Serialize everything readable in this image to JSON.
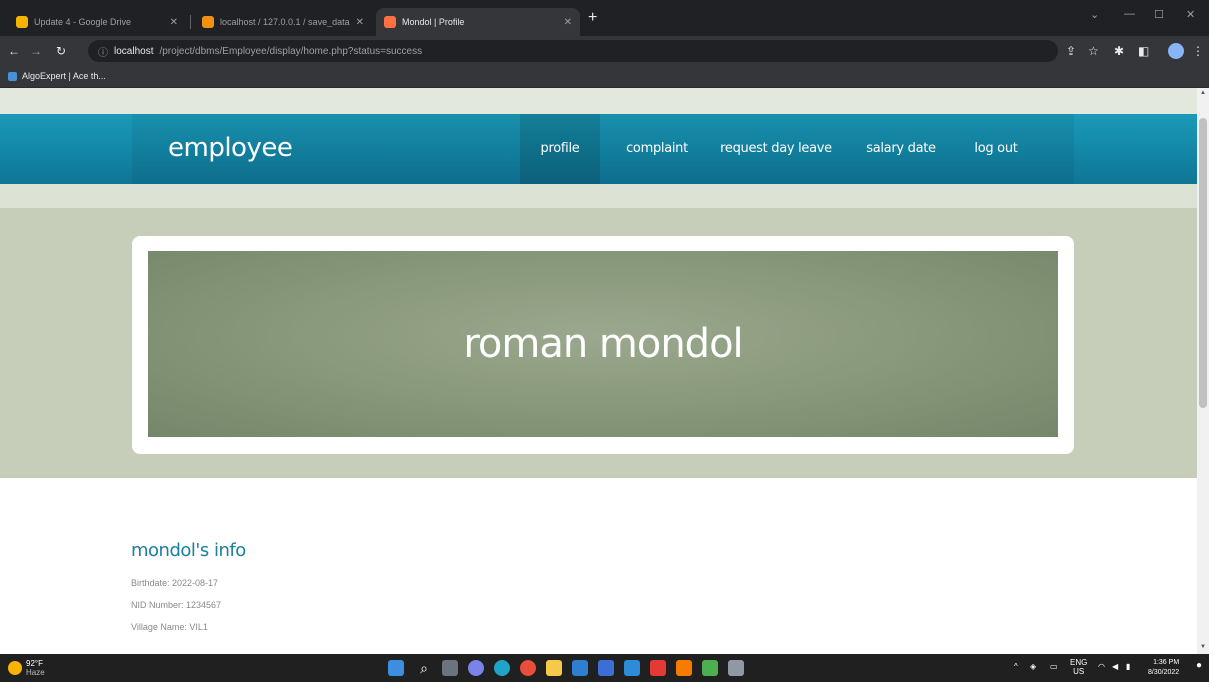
{
  "browser": {
    "tabs": [
      {
        "title": "Update 4 - Google Drive",
        "favicon_color": "#f4b400",
        "active": false
      },
      {
        "title": "localhost / 127.0.0.1 / save_data",
        "favicon_color": "#f29111",
        "active": false
      },
      {
        "title": "Mondol | Profile",
        "favicon_color": "#ff7043",
        "active": true
      }
    ],
    "new_tab": "+",
    "url_host": "localhost",
    "url_path": "/project/dbms/Employee/display/home.php?status=success",
    "bookmarks": [
      {
        "label": "AlgoExpert | Ace th..."
      }
    ]
  },
  "page": {
    "brand": "employee",
    "nav": [
      {
        "label": "profile",
        "active": true
      },
      {
        "label": "complaint",
        "active": false
      },
      {
        "label": "request day leave",
        "active": false
      },
      {
        "label": "salary date",
        "active": false
      },
      {
        "label": "log out",
        "active": false
      }
    ],
    "banner_name": "roman mondol",
    "info_heading": "mondol's info",
    "info_lines": [
      "Birthdate: 2022-08-17",
      "NID Number: 1234567",
      "Village Name: VIL1"
    ]
  },
  "taskbar": {
    "weather_temp": "92°F",
    "weather_desc": "Haze",
    "lang": "ENG",
    "region": "US",
    "time": "1:36 PM",
    "date": "8/30/2022"
  },
  "colors": {
    "navbar": "#1386a6",
    "hero_bg": "#c6ceb9",
    "banner": "#8a9a7c",
    "heading": "#1a7fa0"
  }
}
